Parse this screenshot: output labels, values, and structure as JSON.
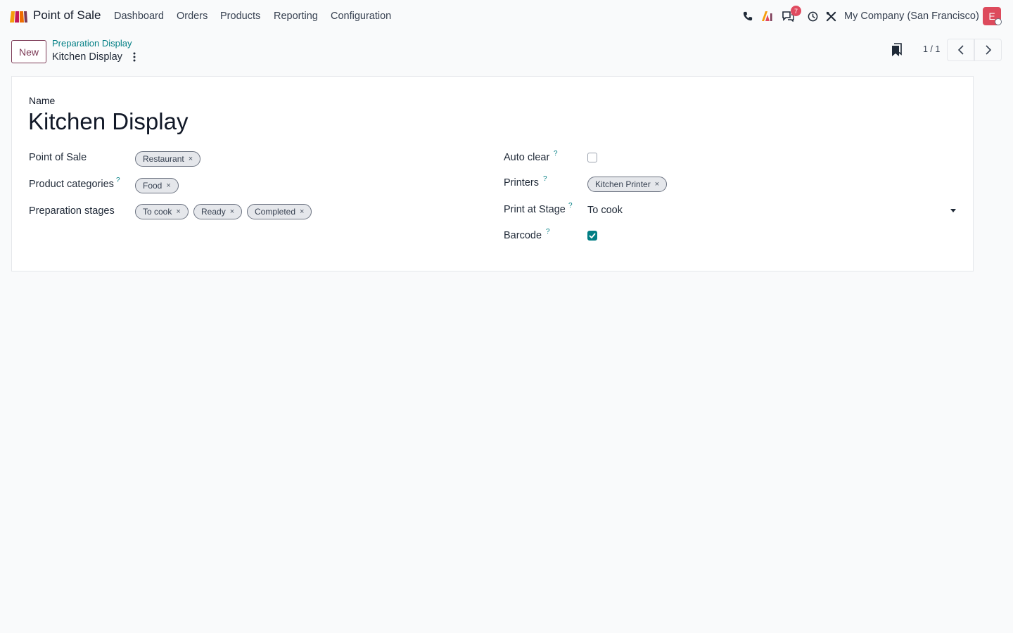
{
  "navbar": {
    "app_name": "Point of Sale",
    "menu": [
      "Dashboard",
      "Orders",
      "Products",
      "Reporting",
      "Configuration"
    ],
    "icons": [
      "phone-icon",
      "ai-icon",
      "messages-icon",
      "clock-icon",
      "tools-icon"
    ],
    "messages_badge": "7",
    "company": "My Company (San Francisco)",
    "avatar_initial": "E"
  },
  "control_panel": {
    "new_button": "New",
    "breadcrumb_parent": "Preparation Display",
    "breadcrumb_current": "Kitchen Display",
    "pager": "1 / 1"
  },
  "form": {
    "name_label": "Name",
    "name_value": "Kitchen Display",
    "left_fields": {
      "pos_label": "Point of Sale",
      "pos_tags": [
        "Restaurant"
      ],
      "categories_label": "Product categories",
      "categories_tags": [
        "Food"
      ],
      "stages_label": "Preparation stages",
      "stages_tags": [
        "To cook",
        "Ready",
        "Completed"
      ]
    },
    "right_fields": {
      "auto_clear_label": "Auto clear",
      "auto_clear_checked": false,
      "printers_label": "Printers",
      "printers_tags": [
        "Kitchen Printer"
      ],
      "print_stage_label": "Print at Stage",
      "print_stage_value": "To cook",
      "barcode_label": "Barcode",
      "barcode_checked": true
    },
    "help_mark": "?",
    "remove_mark": "×"
  },
  "colors": {
    "brand": "#7c3a56",
    "accent": "#017e84",
    "badge": "#e04a5f"
  }
}
